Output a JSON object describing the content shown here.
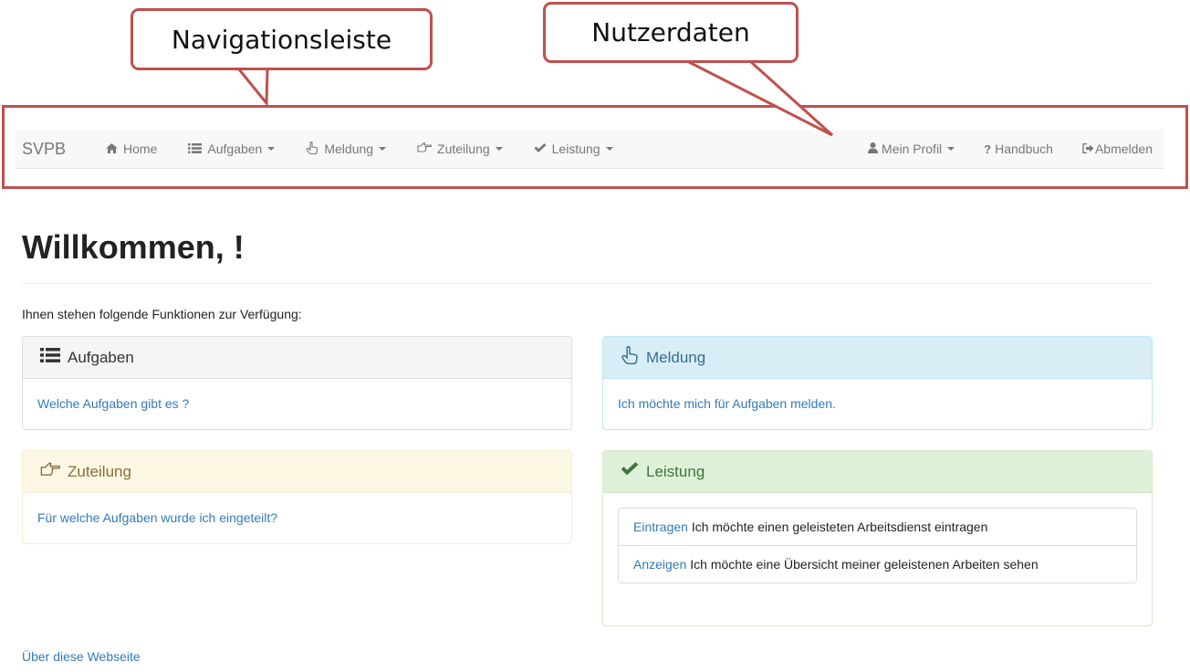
{
  "annotations": {
    "navigation_label": "Navigationsleiste",
    "user_label": "Nutzerdaten",
    "color": "#c0504d"
  },
  "navbar": {
    "brand": "SVPB",
    "items": [
      {
        "label": "Home",
        "icon": "home-icon",
        "dropdown": false
      },
      {
        "label": "Aufgaben",
        "icon": "list-icon",
        "dropdown": true
      },
      {
        "label": "Meldung",
        "icon": "hand-pointer-up-icon",
        "dropdown": true
      },
      {
        "label": "Zuteilung",
        "icon": "hand-pointer-right-icon",
        "dropdown": true
      },
      {
        "label": "Leistung",
        "icon": "checkmark-icon",
        "dropdown": true
      }
    ],
    "right_items": [
      {
        "label": "Mein Profil",
        "icon": "user-icon",
        "dropdown": true
      },
      {
        "label": "Handbuch",
        "icon": "question-icon",
        "dropdown": false
      },
      {
        "label": "Abmelden",
        "icon": "logout-icon",
        "dropdown": false
      }
    ]
  },
  "main": {
    "title": "Willkommen, !",
    "intro": "Ihnen stehen folgende Funktionen zur Verfügung:",
    "panels": {
      "aufgaben": {
        "heading": "Aufgaben",
        "icon": "list-icon",
        "link": "Welche Aufgaben gibt es ?"
      },
      "meldung": {
        "heading": "Meldung",
        "icon": "hand-pointer-up-icon",
        "link": "Ich möchte mich für Aufgaben melden."
      },
      "zuteilung": {
        "heading": "Zuteilung",
        "icon": "hand-pointer-right-icon",
        "link": "Für welche Aufgaben wurde ich eingeteilt?"
      },
      "leistung": {
        "heading": "Leistung",
        "icon": "checkmark-icon",
        "items": [
          {
            "link": "Eintragen",
            "text": "Ich möchte einen geleisteten Arbeitsdienst eintragen"
          },
          {
            "link": "Anzeigen",
            "text": "Ich möchte eine Übersicht meiner geleistenen Arbeiten sehen"
          }
        ]
      }
    }
  },
  "footer": {
    "link": "Über diese Webseite"
  }
}
